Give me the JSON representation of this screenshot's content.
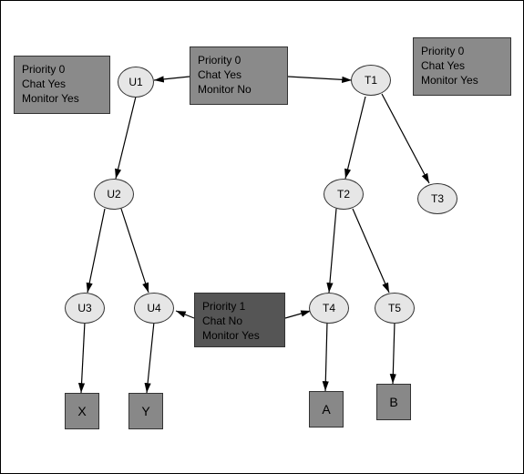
{
  "nodes": {
    "U1": "U1",
    "U2": "U2",
    "U3": "U3",
    "U4": "U4",
    "T1": "T1",
    "T2": "T2",
    "T3": "T3",
    "T4": "T4",
    "T5": "T5"
  },
  "leaves": {
    "X": "X",
    "Y": "Y",
    "A": "A",
    "B": "B"
  },
  "info_left": {
    "priority": "Priority 0",
    "chat": "Chat    Yes",
    "monitor": "Monitor Yes"
  },
  "info_center": {
    "priority": "Priority 0",
    "chat": "Chat     Yes",
    "monitor": "Monitor No"
  },
  "info_right": {
    "priority": "Priority 0",
    "chat": "Chat    Yes",
    "monitor": "Monitor Yes"
  },
  "info_mid": {
    "priority": "Priority 1",
    "chat": "Chat     No",
    "monitor": "Monitor Yes"
  }
}
